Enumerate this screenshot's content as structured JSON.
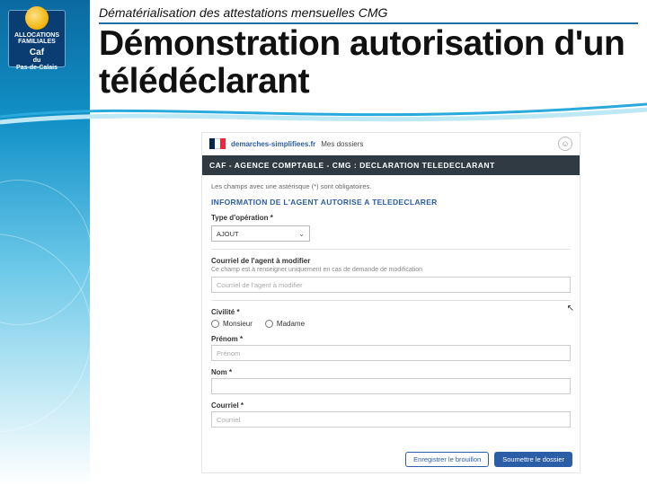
{
  "slide": {
    "pre_title": "Dématérialisation des attestations mensuelles CMG",
    "title": "Démonstration autorisation d'un télédéclarant",
    "logo_lines": [
      "ALLOCATIONS",
      "FAMILIALES",
      "Caf",
      "du",
      "Pas-de-Calais"
    ]
  },
  "form": {
    "brand": "demarches-simplifiees.fr",
    "header_link": "Mes dossiers",
    "banner": "CAF - AGENCE COMPTABLE - CMG : DECLARATION TELEDECLARANT",
    "mandatory_hint": "Les champs avec une astérisque (*) sont obligatoires.",
    "section": "INFORMATION DE L'AGENT AUTORISE A TELEDECLARER",
    "type_op_label": "Type d'opération *",
    "type_op_value": "AJOUT",
    "courriel_mod_label": "Courriel de l'agent à modifier",
    "courriel_mod_hint": "Ce champ est à renseigner uniquement en cas de demande de modification",
    "courriel_mod_placeholder": "Courriel de l'agent à modifier",
    "civilite_label": "Civilité *",
    "civ_options": [
      "Monsieur",
      "Madame"
    ],
    "prenom_label": "Prénom *",
    "prenom_placeholder": "Prénom",
    "nom_label": "Nom *",
    "courriel_label": "Courriel *",
    "courriel_placeholder": "Courriel",
    "btn_draft": "Enregistrer le brouillon",
    "btn_submit": "Soumettre le dossier"
  }
}
